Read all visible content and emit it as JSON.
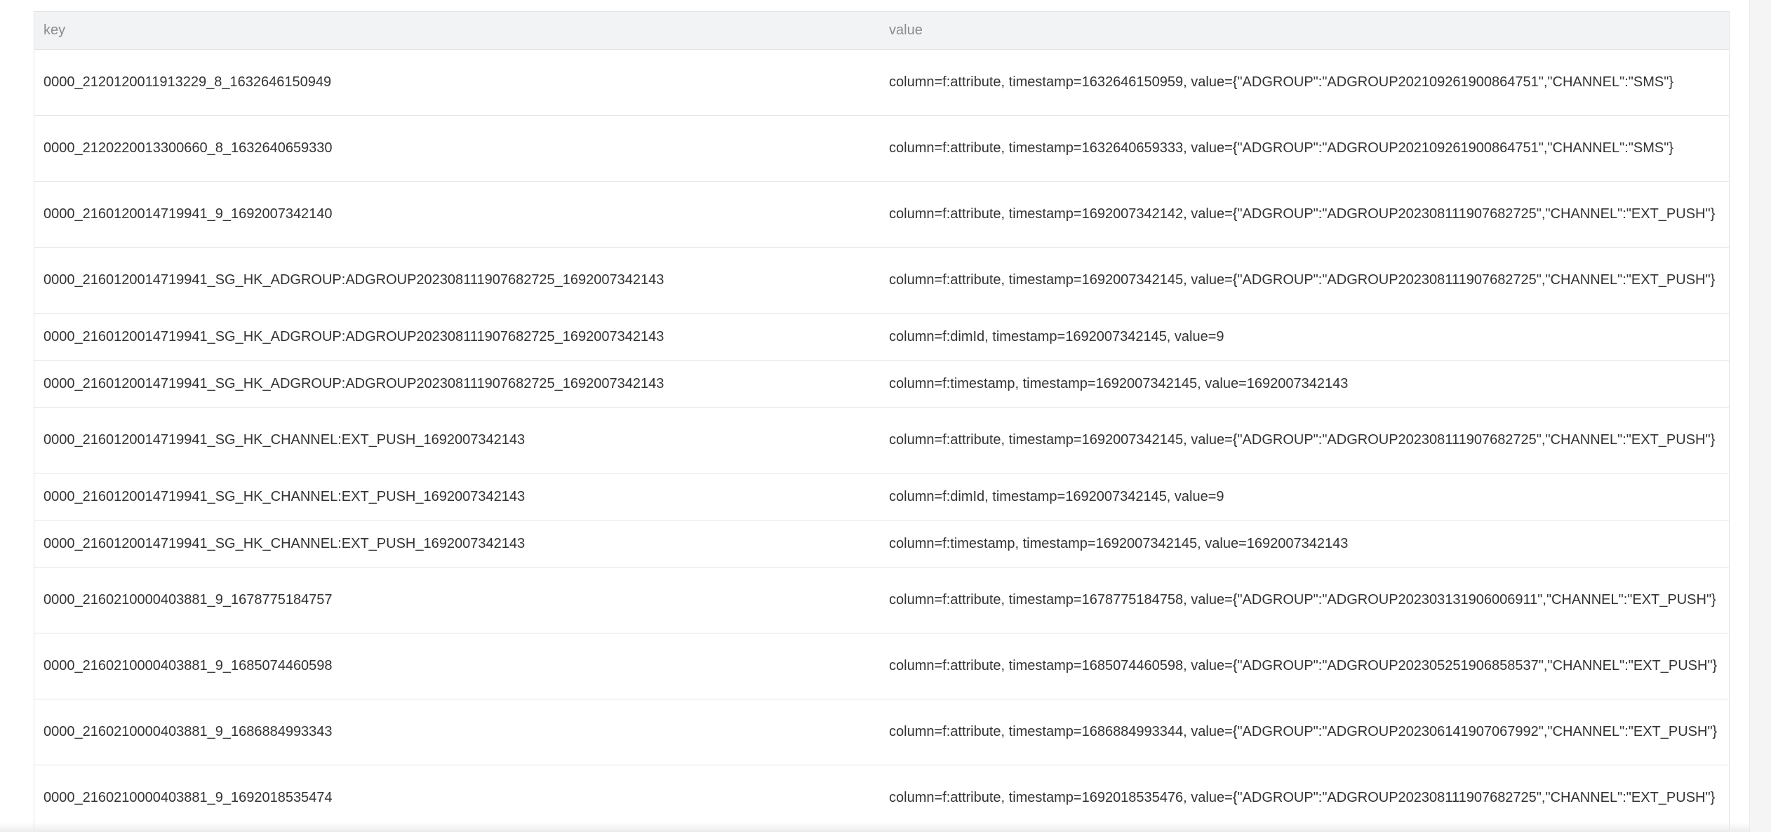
{
  "table": {
    "headers": {
      "key": "key",
      "value": "value"
    },
    "rows": [
      {
        "key": "0000_2120120011913229_8_1632646150949",
        "value": "column=f:attribute, timestamp=1632646150959, value={\"ADGROUP\":\"ADGROUP20210926190086475​1\",\"CHANNEL\":\"SMS\"}",
        "size": "tall"
      },
      {
        "key": "0000_2120220013300660_8_1632640659330",
        "value": "column=f:attribute, timestamp=1632640659333, value={\"ADGROUP\":\"ADGROUP20210926190086475​1\",\"CHANNEL\":\"SMS\"}",
        "size": "tall"
      },
      {
        "key": "0000_2160120014719941_9_1692007342140",
        "value": "column=f:attribute, timestamp=1692007342142, value={\"ADGROUP\":\"ADGROUP20230811190768272​5\",\"CHANNEL\":\"EXT_PUSH\"}",
        "size": "tall"
      },
      {
        "key": "0000_2160120014719941_SG_HK_ADGROUP:ADGROUP202308111907682725_1692007342143",
        "value": "column=f:attribute, timestamp=1692007342145, value={\"ADGROUP\":\"ADGROUP20230811190768272​5\",\"CHANNEL\":\"EXT_PUSH\"}",
        "size": "tall"
      },
      {
        "key": "0000_2160120014719941_SG_HK_ADGROUP:ADGROUP202308111907682725_1692007342143",
        "value": "column=f:dimId, timestamp=1692007342145, value=9",
        "size": "short"
      },
      {
        "key": "0000_2160120014719941_SG_HK_ADGROUP:ADGROUP202308111907682725_1692007342143",
        "value": "column=f:timestamp, timestamp=1692007342145, value=1692007342143",
        "size": "short"
      },
      {
        "key": "0000_2160120014719941_SG_HK_CHANNEL:EXT_PUSH_1692007342143",
        "value": "column=f:attribute, timestamp=1692007342145, value={\"ADGROUP\":\"ADGROUP20230811190768272​5\",\"CHANNEL\":\"EXT_PUSH\"}",
        "size": "tall"
      },
      {
        "key": "0000_2160120014719941_SG_HK_CHANNEL:EXT_PUSH_1692007342143",
        "value": "column=f:dimId, timestamp=1692007342145, value=9",
        "size": "short"
      },
      {
        "key": "0000_2160120014719941_SG_HK_CHANNEL:EXT_PUSH_1692007342143",
        "value": "column=f:timestamp, timestamp=1692007342145, value=1692007342143",
        "size": "short"
      },
      {
        "key": "0000_2160210000403881_9_1678775184757",
        "value": "column=f:attribute, timestamp=1678775184758, value={\"ADGROUP\":\"ADGROUP20230313190600691​1\",\"CHANNEL\":\"EXT_PUSH\"}",
        "size": "tall"
      },
      {
        "key": "0000_2160210000403881_9_1685074460598",
        "value": "column=f:attribute, timestamp=1685074460598, value={\"ADGROUP\":\"ADGROUP20230525190685853​7\",\"CHANNEL\":\"EXT_PUSH\"}",
        "size": "tall"
      },
      {
        "key": "0000_2160210000403881_9_1686884993343",
        "value": "column=f:attribute, timestamp=1686884993344, value={\"ADGROUP\":\"ADGROUP20230614190706799​2\",\"CHANNEL\":\"EXT_PUSH\"}",
        "size": "tall"
      },
      {
        "key": "0000_2160210000403881_9_1692018535474",
        "value": "column=f:attribute, timestamp=1692018535476, value={\"ADGROUP\":\"ADGROUP20230811190768272​5\",\"CHANNEL\":\"EXT_PUSH\"}",
        "size": "tall"
      }
    ]
  }
}
